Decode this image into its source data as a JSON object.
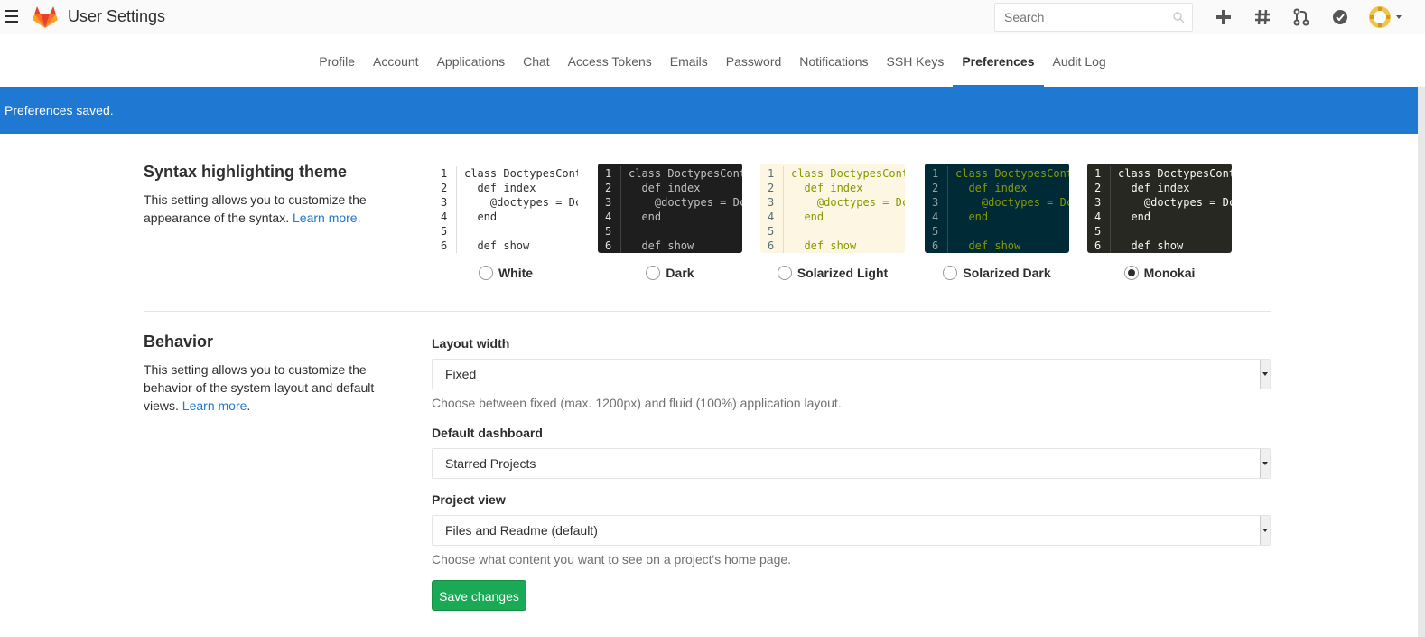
{
  "header": {
    "title": "User Settings",
    "search_placeholder": "Search",
    "icons": [
      "hamburger-icon",
      "gitlab-logo",
      "plus-icon",
      "hash-icon",
      "merge-request-icon",
      "todo-check-icon",
      "avatar"
    ]
  },
  "tabs": [
    {
      "label": "Profile"
    },
    {
      "label": "Account"
    },
    {
      "label": "Applications"
    },
    {
      "label": "Chat"
    },
    {
      "label": "Access Tokens"
    },
    {
      "label": "Emails"
    },
    {
      "label": "Password"
    },
    {
      "label": "Notifications"
    },
    {
      "label": "SSH Keys"
    },
    {
      "label": "Preferences",
      "active": true
    },
    {
      "label": "Audit Log"
    }
  ],
  "flash": {
    "message": "Preferences saved."
  },
  "syntax": {
    "title": "Syntax highlighting theme",
    "desc": "This setting allows you to customize the appearance of the syntax.",
    "learn_more": "Learn more",
    "line_numbers": "1\n2\n3\n4\n5\n6",
    "code_lines": [
      "class DoctypesCont",
      "  def index",
      "    @doctypes = Dc",
      "  end",
      "",
      "  def show"
    ],
    "themes": [
      {
        "label": "White",
        "checked": false,
        "bg": "#ffffff",
        "gutter_fg": "#2e2e2e",
        "fg": "#2e2e2e"
      },
      {
        "label": "Dark",
        "checked": false,
        "bg": "#1e1e1e",
        "gutter_fg": "#e0e0e0",
        "fg": "#c0c0c0"
      },
      {
        "label": "Solarized Light",
        "checked": false,
        "bg": "#fdf6e3",
        "gutter_fg": "#586e75",
        "fg": "#859900"
      },
      {
        "label": "Solarized Dark",
        "checked": false,
        "bg": "#002b36",
        "gutter_fg": "#93a1a1",
        "fg": "#859900"
      },
      {
        "label": "Monokai",
        "checked": true,
        "bg": "#272822",
        "gutter_fg": "#f8f8f2",
        "fg": "#f8f8f2"
      }
    ]
  },
  "behavior": {
    "title": "Behavior",
    "desc": "This setting allows you to customize the behavior of the system layout and default views.",
    "learn_more": "Learn more",
    "layout_width": {
      "label": "Layout width",
      "value": "Fixed",
      "help": "Choose between fixed (max. 1200px) and fluid (100%) application layout."
    },
    "default_dashboard": {
      "label": "Default dashboard",
      "value": "Starred Projects"
    },
    "project_view": {
      "label": "Project view",
      "value": "Files and Readme (default)",
      "help": "Choose what content you want to see on a project's home page."
    },
    "save_label": "Save changes"
  },
  "colors": {
    "accent": "#1f78d1",
    "success": "#1aaa55"
  }
}
